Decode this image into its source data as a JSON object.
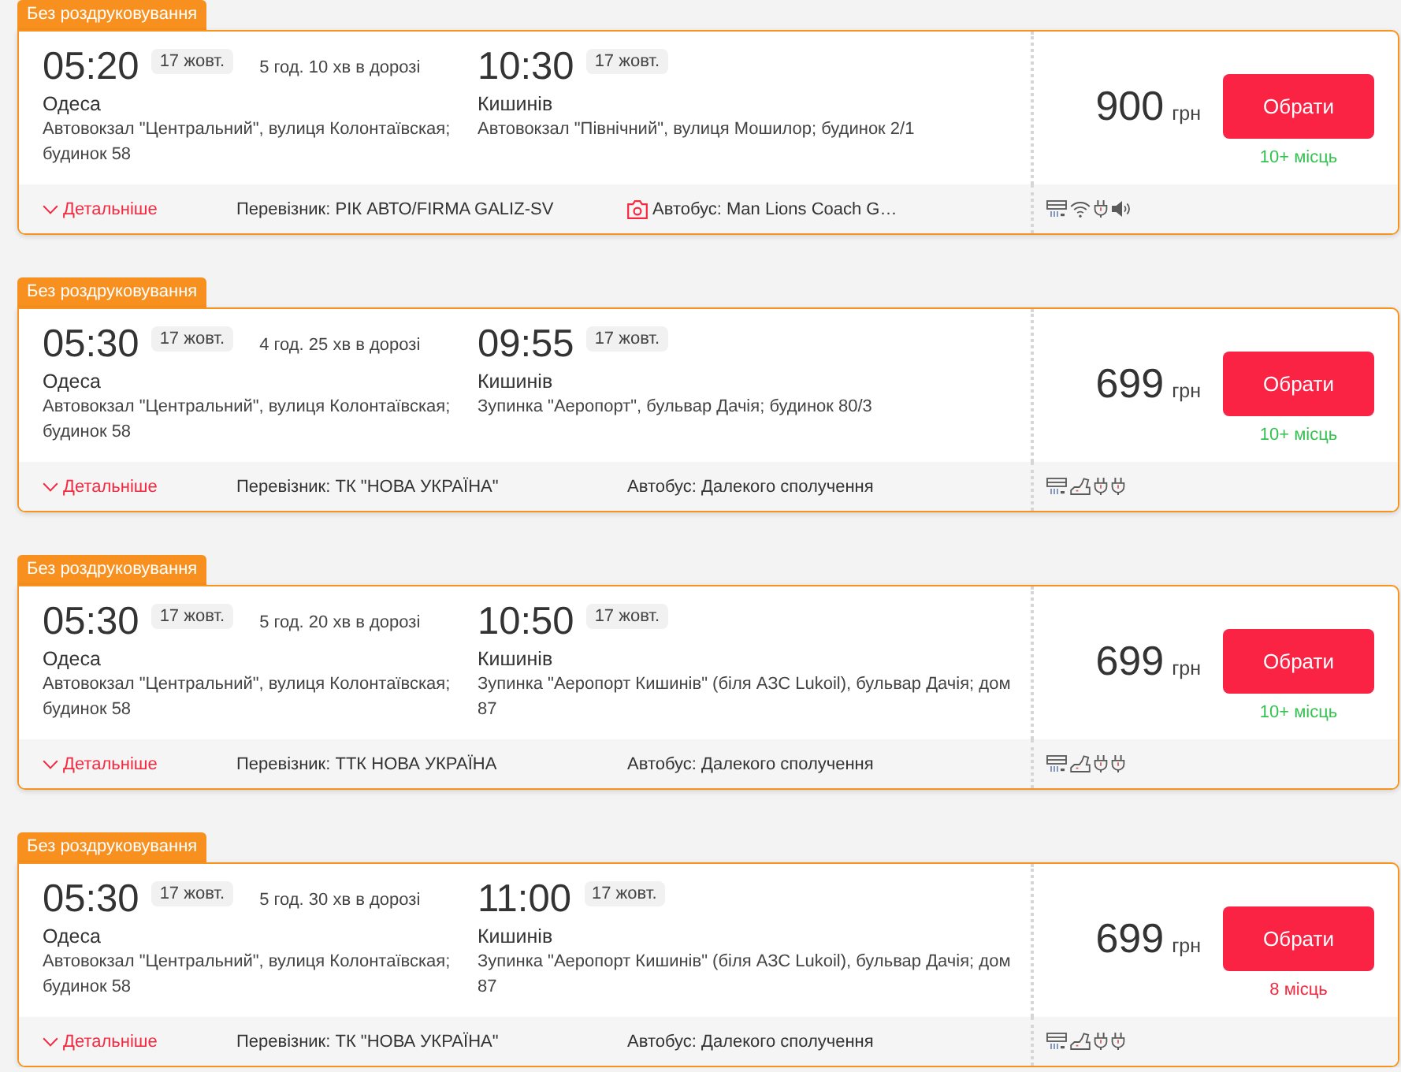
{
  "trips": [
    {
      "tag": "Без роздруковування",
      "departure": {
        "time": "05:20",
        "date": "17 жовт.",
        "city": "Одеса",
        "address": "Автовокзал \"Центральний\", вулиця Колонтаївская; будинок 58"
      },
      "duration": "5 год. 10 хв в дорозі",
      "arrival": {
        "time": "10:30",
        "date": "17 жовт.",
        "city": "Кишинів",
        "address": "Автовокзал \"Північний\", вулиця Мошилор; будинок 2/1"
      },
      "price": "900",
      "currency": "грн",
      "button": "Обрати",
      "seats": "10+ місць",
      "seats_low": false,
      "details": "Детальніше",
      "carrier": "Перевізник: РІК АВТО/FIRMA GALIZ-SV",
      "bus": "Автобус: Man Lions Coach G…",
      "bus_photo": true,
      "amenities": [
        {
          "kind": "ac"
        },
        {
          "kind": "wifi"
        },
        {
          "kind": "socket"
        },
        {
          "kind": "audio"
        }
      ]
    },
    {
      "tag": "Без роздруковування",
      "departure": {
        "time": "05:30",
        "date": "17 жовт.",
        "city": "Одеса",
        "address": "Автовокзал \"Центральний\", вулиця Колонтаївская; будинок 58"
      },
      "duration": "4 год. 25 хв в дорозі",
      "arrival": {
        "time": "09:55",
        "date": "17 жовт.",
        "city": "Кишинів",
        "address": "Зупинка \"Аеропорт\", бульвар Дачія; будинок 80/3"
      },
      "price": "699",
      "currency": "грн",
      "button": "Обрати",
      "seats": "10+ місць",
      "seats_low": false,
      "details": "Детальніше",
      "carrier": "Перевізник: ТК \"НОВА УКРАЇНА\"",
      "bus": "Автобус: Далекого сполучення",
      "bus_photo": false,
      "amenities": [
        {
          "kind": "ac"
        },
        {
          "kind": "seat"
        },
        {
          "kind": "socket"
        },
        {
          "kind": "socket"
        }
      ]
    },
    {
      "tag": "Без роздруковування",
      "departure": {
        "time": "05:30",
        "date": "17 жовт.",
        "city": "Одеса",
        "address": "Автовокзал \"Центральний\", вулиця Колонтаївская; будинок 58"
      },
      "duration": "5 год. 20 хв в дорозі",
      "arrival": {
        "time": "10:50",
        "date": "17 жовт.",
        "city": "Кишинів",
        "address": "Зупинка \"Аеропорт Кишинів\" (біля АЗС Lukoil), бульвар Дачія; дом 87"
      },
      "price": "699",
      "currency": "грн",
      "button": "Обрати",
      "seats": "10+ місць",
      "seats_low": false,
      "details": "Детальніше",
      "carrier": "Перевізник: ТТК НОВА УКРАЇНА",
      "bus": "Автобус: Далекого сполучення",
      "bus_photo": false,
      "amenities": [
        {
          "kind": "ac"
        },
        {
          "kind": "seat"
        },
        {
          "kind": "socket"
        },
        {
          "kind": "socket"
        }
      ]
    },
    {
      "tag": "Без роздруковування",
      "departure": {
        "time": "05:30",
        "date": "17 жовт.",
        "city": "Одеса",
        "address": "Автовокзал \"Центральний\", вулиця Колонтаївская; будинок 58"
      },
      "duration": "5 год. 30 хв в дорозі",
      "arrival": {
        "time": "11:00",
        "date": "17 жовт.",
        "city": "Кишинів",
        "address": "Зупинка \"Аеропорт Кишинів\" (біля АЗС Lukoil), бульвар Дачія; дом 87"
      },
      "price": "699",
      "currency": "грн",
      "button": "Обрати",
      "seats": "8 місць",
      "seats_low": true,
      "details": "Детальніше",
      "carrier": "Перевізник: ТК \"НОВА УКРАЇНА\"",
      "bus": "Автобус: Далекого сполучення",
      "bus_photo": false,
      "amenities": [
        {
          "kind": "ac"
        },
        {
          "kind": "seat"
        },
        {
          "kind": "socket"
        },
        {
          "kind": "socket"
        }
      ]
    }
  ]
}
